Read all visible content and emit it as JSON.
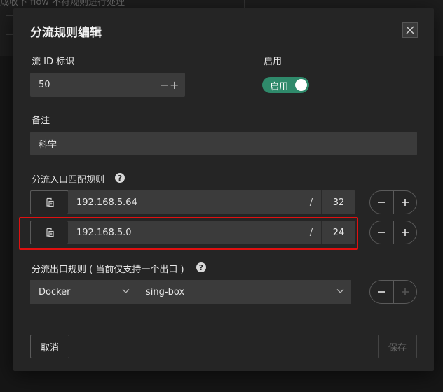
{
  "background": {
    "text": "成收下 flow 不符规则进行处理"
  },
  "dialog": {
    "title": "分流规则编辑",
    "flow_id": {
      "label": "流 ID 标识",
      "value": "50",
      "minus": "−",
      "plus": "+"
    },
    "enable": {
      "label": "启用",
      "toggle_text": "启用",
      "checked": true
    },
    "remark": {
      "label": "备注",
      "value": "科学"
    },
    "entry_rules": {
      "label": "分流入口匹配规则",
      "help": "?",
      "rows": [
        {
          "ip": "192.168.5.64",
          "separator": "/",
          "mask": "32"
        },
        {
          "ip": "192.168.5.0",
          "separator": "/",
          "mask": "24"
        }
      ]
    },
    "exit_rules": {
      "label": "分流出口规则 ( 当前仅支持一个出口 )",
      "help": "?",
      "type_value": "Docker",
      "target_value": "sing-box"
    },
    "cancel_label": "取消",
    "save_label": "保存"
  },
  "colors": {
    "accent_green": "#2f8a6b",
    "highlight_red": "#e01010",
    "dialog_bg": "#252525",
    "input_bg": "#3b3b3b"
  }
}
